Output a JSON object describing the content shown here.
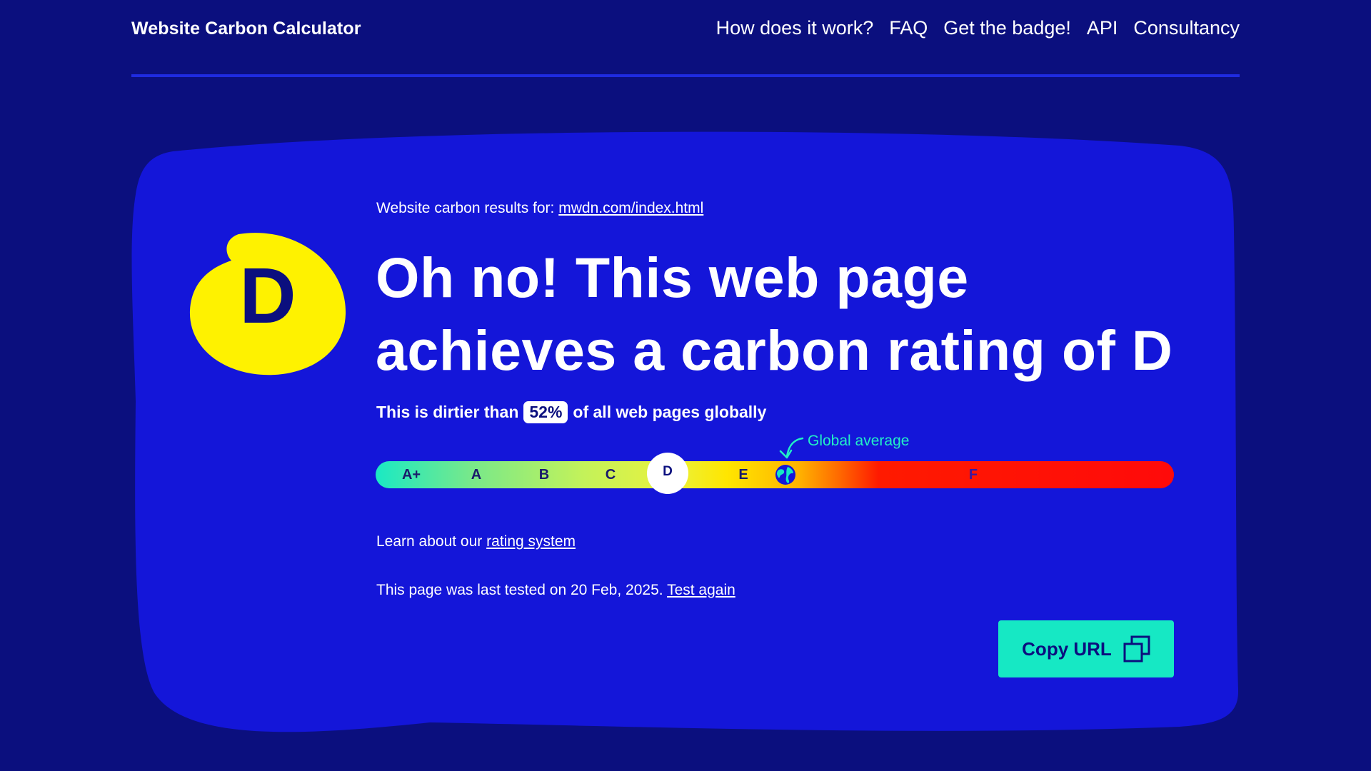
{
  "header": {
    "brand": "Website Carbon Calculator",
    "nav": [
      "How does it work?",
      "FAQ",
      "Get the badge!",
      "API",
      "Consultancy"
    ]
  },
  "result": {
    "intro": "Website carbon results for:",
    "url": "mwdn.com/index.html",
    "grade": "D",
    "headline_line1": "Oh no! This web page",
    "headline_line2": "achieves a carbon rating of D",
    "dirtier_prefix": "This is dirtier than",
    "dirtier_pct": "52%",
    "dirtier_suffix": "of all web pages globally",
    "global_average_label": "Global average",
    "scale_grades": [
      "A+",
      "A",
      "B",
      "C",
      "D",
      "E",
      "F"
    ],
    "learn_prefix": "Learn about our",
    "learn_link": "rating system",
    "tested_text": "This page was last tested on 20 Feb, 2025.",
    "test_again": "Test again",
    "copy_button": "Copy URL"
  },
  "colors": {
    "background": "#0b0f7e",
    "card": "#1416d9",
    "badge": "#fef200",
    "accent": "#16e8c4"
  },
  "icons": {
    "copy": "copy-icon",
    "globe": "globe-icon",
    "arrow": "curved-arrow-icon"
  }
}
